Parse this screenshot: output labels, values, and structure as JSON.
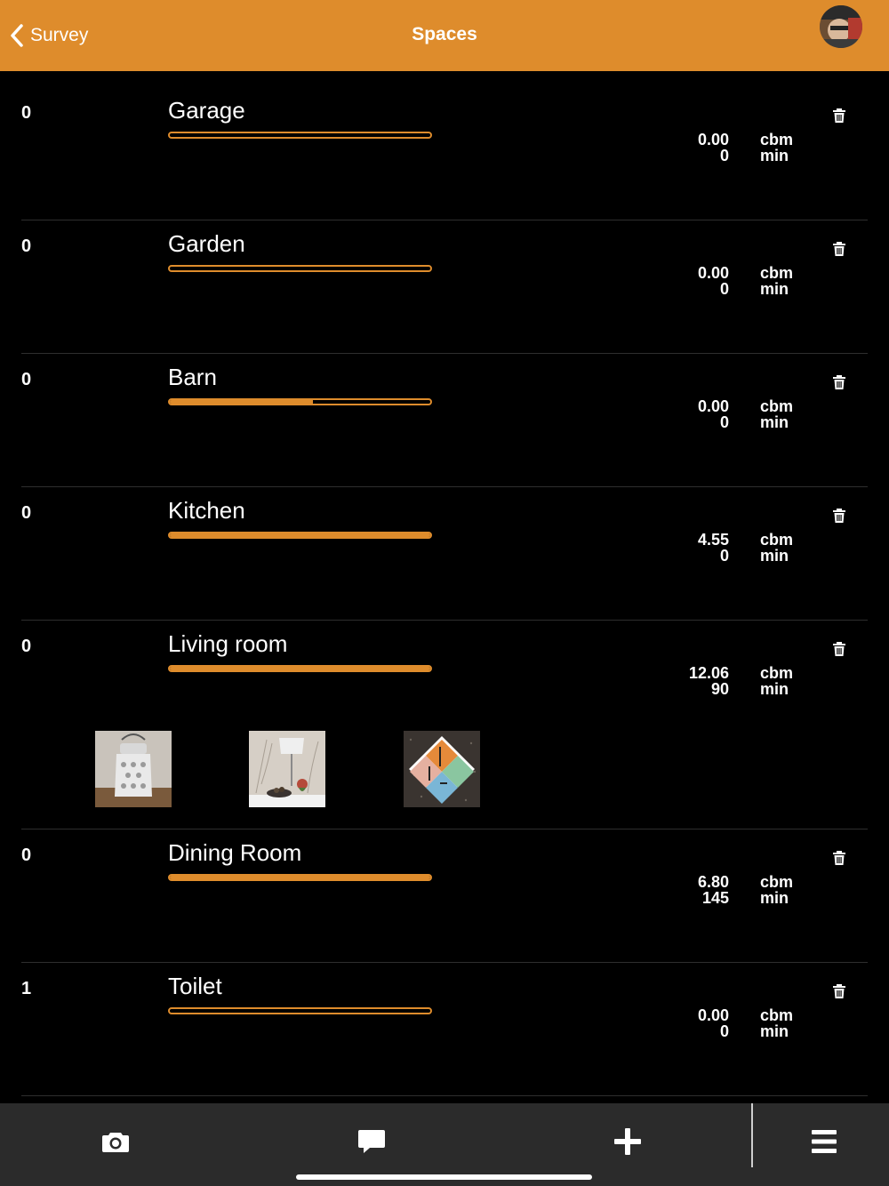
{
  "header": {
    "back_label": "Survey",
    "title": "Spaces",
    "accent_color": "#de8c2c"
  },
  "rows": [
    {
      "count": "0",
      "name": "Garage",
      "progress": 0,
      "volume": "0.00",
      "minutes": "0",
      "unit_volume": "cbm",
      "unit_time": "min"
    },
    {
      "count": "0",
      "name": "Garden",
      "progress": 0,
      "volume": "0.00",
      "minutes": "0",
      "unit_volume": "cbm",
      "unit_time": "min"
    },
    {
      "count": "0",
      "name": "Barn",
      "progress": 0.55,
      "volume": "0.00",
      "minutes": "0",
      "unit_volume": "cbm",
      "unit_time": "min"
    },
    {
      "count": "0",
      "name": "Kitchen",
      "progress": 1,
      "volume": "4.55",
      "minutes": "0",
      "unit_volume": "cbm",
      "unit_time": "min"
    },
    {
      "count": "0",
      "name": "Living room",
      "progress": 1,
      "volume": "12.06",
      "minutes": "90",
      "unit_volume": "cbm",
      "unit_time": "min"
    },
    {
      "count": "0",
      "name": "Dining Room",
      "progress": 1,
      "volume": "6.80",
      "minutes": "145",
      "unit_volume": "cbm",
      "unit_time": "min"
    },
    {
      "count": "1",
      "name": "Toilet",
      "progress": 0,
      "volume": "0.00",
      "minutes": "0",
      "unit_volume": "cbm",
      "unit_time": "min"
    }
  ],
  "thumbnails": [
    "lantern-photo",
    "vase-photo",
    "painting-photo"
  ],
  "bottom_bar": {
    "icons": [
      "camera-icon",
      "comment-icon",
      "add-icon",
      "menu-icon"
    ]
  }
}
